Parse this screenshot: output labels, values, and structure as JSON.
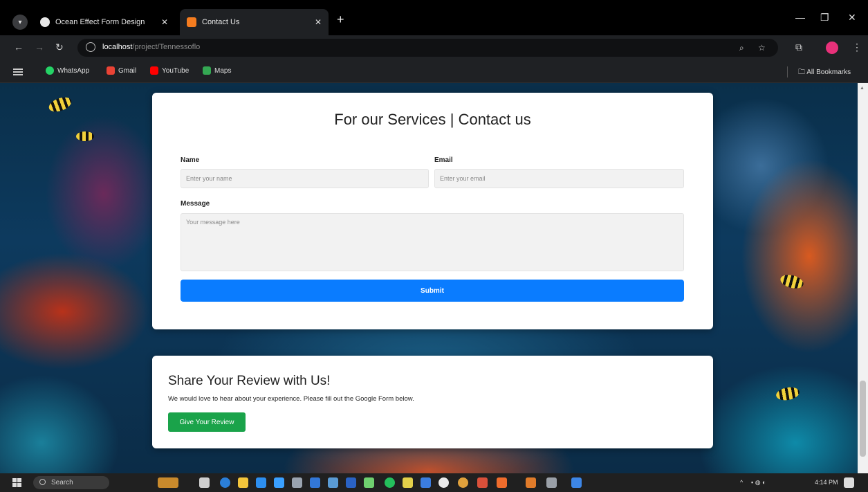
{
  "browser": {
    "tabs": [
      {
        "title": "Ocean Effect Form Design",
        "active": false
      },
      {
        "title": "Contact Us",
        "active": true
      }
    ],
    "new_tab_symbol": "+",
    "address": {
      "host": "localhost",
      "path": "/project/Tennessoflo"
    },
    "bookmarks": [
      {
        "label": "WhatsApp",
        "color": "#25d366"
      },
      {
        "label": "Gmail",
        "color": "#ea4335"
      },
      {
        "label": "YouTube",
        "color": "#ff0000"
      },
      {
        "label": "Maps",
        "color": "#34a853"
      }
    ],
    "all_bookmarks": "All Bookmarks"
  },
  "contact_form": {
    "title": "For our Services | Contact us",
    "name_label": "Name",
    "name_placeholder": "Enter your name",
    "email_label": "Email",
    "email_placeholder": "Enter your email",
    "message_label": "Message",
    "message_placeholder": "Your message here",
    "submit_label": "Submit",
    "submit_color": "#0a7cff"
  },
  "review": {
    "title": "Share Your Review with Us!",
    "text": "We would love to hear about your experience. Please fill out the Google Form below.",
    "button_label": "Give Your Review",
    "button_color": "#1aa34a"
  },
  "taskbar": {
    "search_label": "Search",
    "time": "4:14 PM"
  }
}
